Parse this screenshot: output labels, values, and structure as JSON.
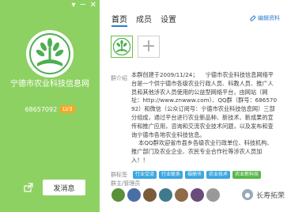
{
  "window": {
    "controls": [
      "▾",
      "─",
      "✕"
    ]
  },
  "left_panel": {
    "group_name": "宁德市农业科技信息网",
    "group_id": "68657092",
    "level_badge": "LV3",
    "share_icon": "share-icon",
    "message_button": "发消息"
  },
  "tabs": [
    "首页",
    "成员",
    "设置"
  ],
  "edit_link": "编辑资料",
  "intro": {
    "label": "群介绍",
    "text": "本群创建于2009/11/24；    宁德市农业科技信息网络平台是一个供宁德市各级农业行政人员、科教人员、推广人员和其他涉农人员使用的公益型网络平台，由网站（网址：http://www.znwww.com）、QQ群（群号：68657092）和微信（公众订阅号：宁德市农业科技信息网）三部分组成，通过平台进行农业新品种、新技术、新成果的宣传和推广应用，咨询和交流农业技术问题，以及发布和查询宁德市各地农业科技信息。\n    本QQ群欢迎省市县乡各级农业行政单位、科技机构、推广部门及农业企业、农民专业合作社等涉农人员加入！！"
  },
  "tags": {
    "label": "群标签",
    "items": [
      "行业交流",
      "行业联系",
      "福鼎市",
      "农业技术",
      "农业新科技"
    ]
  },
  "admins": {
    "label": "群主/管理员",
    "avatar_colors": [
      "#5a8f3c",
      "#4a6fa5",
      "#7a5c3a",
      "#3f7a8c",
      "#8f6b4a",
      "#6a4c7a",
      "#999999"
    ]
  },
  "watermark": {
    "text": "长寿拓荣",
    "icon": "wechat-official-icon"
  },
  "colors": {
    "left_bg": "#8ed163",
    "accent": "#2a7dd1",
    "tag_blue": "#3ba7e0",
    "tag_green": "#57b84a",
    "badge": "#f5a623"
  }
}
